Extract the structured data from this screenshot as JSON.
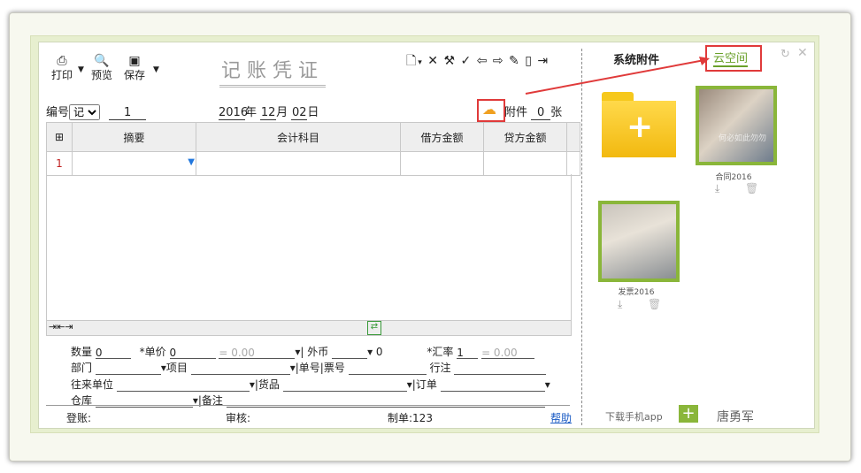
{
  "toolbar": {
    "print_label": "打印",
    "preview_label": "预览",
    "save_label": "保存"
  },
  "voucher": {
    "title": "记账凭证",
    "number_label": "编号",
    "type_value": "记",
    "number_value": "1",
    "year": "2016",
    "year_unit": "年",
    "month": "12",
    "month_unit": "月",
    "day": "02",
    "day_unit": "日",
    "attach_label": "附件",
    "attach_count": "0",
    "attach_unit": "张",
    "columns": [
      "摘要",
      "会计科目",
      "借方金额",
      "贷方金额"
    ],
    "rows": [
      {
        "index": "1",
        "summary": "",
        "account": "",
        "debit": "",
        "credit": ""
      }
    ]
  },
  "detail_fields": {
    "qty_label": "数量",
    "qty_value": "0",
    "price_label": "*单价",
    "price_value": "0",
    "eq1": "= 0.00",
    "currency_label": "外币",
    "currency_value": "0",
    "rate_label": "*汇率",
    "rate_value": "1",
    "eq2": "= 0.00",
    "dept_label": "部门",
    "project_label": "项目",
    "ticket_label": "单号|票号",
    "note_label": "行注",
    "partner_label": "往来单位",
    "goods_label": "货品",
    "order_label": "订单",
    "warehouse_label": "仓库",
    "remark_label": "备注"
  },
  "footer": {
    "post_label": "登账:",
    "review_label": "审核:",
    "maker_label": "制单:123",
    "help_label": "帮助"
  },
  "sidebar": {
    "tab_system": "系统附件",
    "tab_cloud": "云空间",
    "files": [
      {
        "name": "合同2016"
      },
      {
        "name": "发票2016"
      }
    ],
    "download_app": "下载手机app",
    "user_name": "唐勇军"
  },
  "colors": {
    "accent_green": "#8ab63a",
    "highlight_red": "#e03a3a",
    "folder_yellow": "#f6c81c"
  }
}
